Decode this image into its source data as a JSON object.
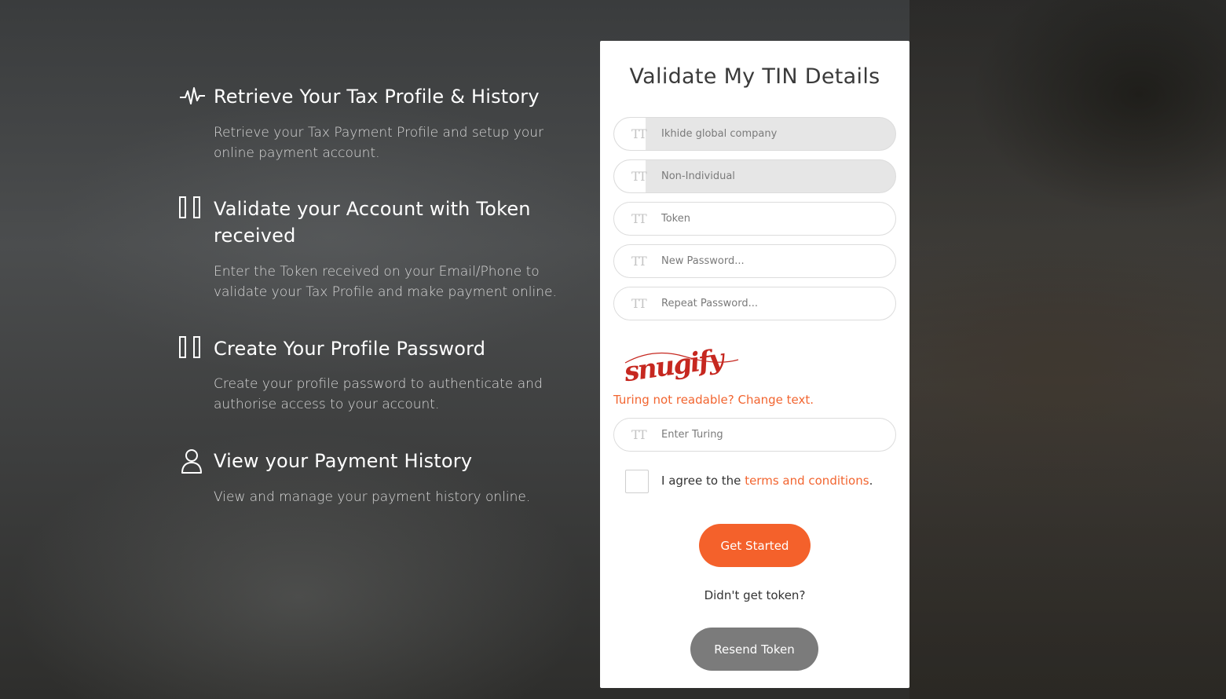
{
  "features": [
    {
      "icon": "pulse-icon",
      "title": "Retrieve Your Tax Profile & History",
      "description": "Retrieve your Tax Payment Profile and setup your online payment account."
    },
    {
      "icon": "missing-glyph-icon",
      "title": "Validate your Account with Token received",
      "description": "Enter the Token received on your Email/Phone to validate your Tax Profile and make payment online."
    },
    {
      "icon": "missing-glyph-icon",
      "title": "Create Your Profile Password",
      "description": "Create your profile password to authenticate and authorise access to your account."
    },
    {
      "icon": "user-icon",
      "title": "View your Payment History",
      "description": "View and manage your payment history online."
    }
  ],
  "form": {
    "title": "Validate My TIN Details",
    "field_icon": "text-format-icon",
    "company_name": {
      "value": "Ikhide global company"
    },
    "taxpayer_type": {
      "value": "Non-Individual"
    },
    "token": {
      "placeholder": "Token"
    },
    "new_password": {
      "placeholder": "New Password..."
    },
    "repeat_password": {
      "placeholder": "Repeat Password..."
    },
    "captcha_text": "snugify",
    "captcha_change_link": "Turing not readable? Change text.",
    "turing": {
      "placeholder": "Enter Turing"
    },
    "agree_prefix": "I agree to the ",
    "agree_link": "terms and conditions",
    "agree_suffix": ".",
    "submit_label": "Get Started",
    "no_token_text": "Didn't get token?",
    "resend_label": "Resend Token"
  },
  "colors": {
    "accent": "#f4612b",
    "link": "#f26530",
    "secondary_button": "#7b7b7b"
  }
}
